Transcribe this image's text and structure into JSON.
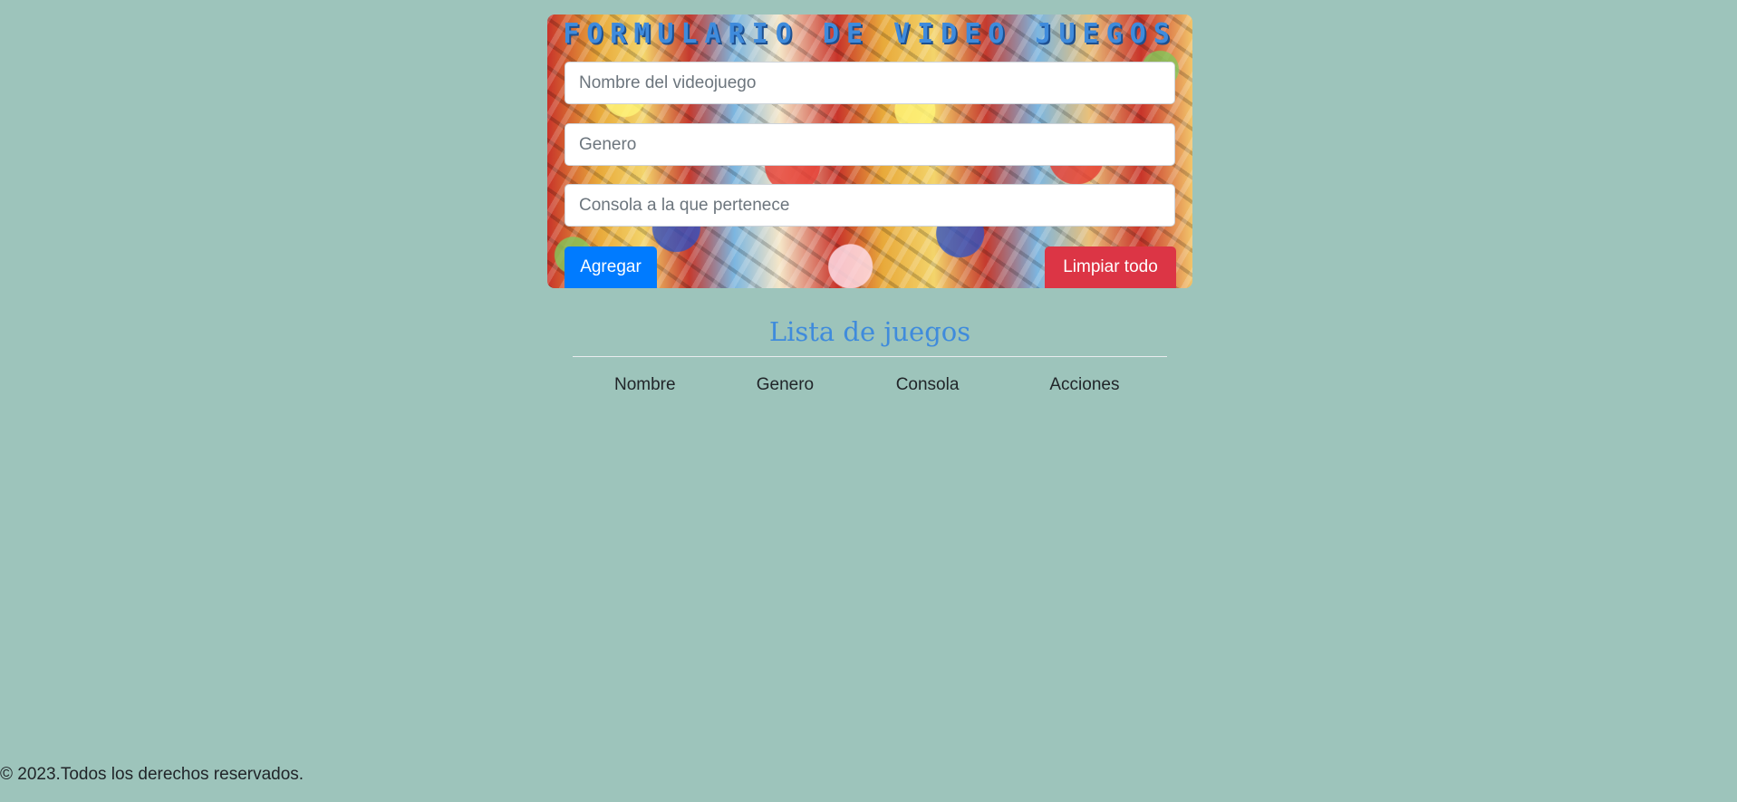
{
  "form": {
    "title": "FORMULARIO DE VIDEO JUEGOS",
    "fields": {
      "nombre_placeholder": "Nombre del videojuego",
      "genero_placeholder": "Genero",
      "consola_placeholder": "Consola a la que pertenece"
    },
    "buttons": {
      "agregar": "Agregar",
      "limpiar": "Limpiar todo"
    }
  },
  "list": {
    "title": "Lista de juegos",
    "columns": [
      "Nombre",
      "Genero",
      "Consola",
      "Acciones"
    ],
    "rows": []
  },
  "footer": {
    "text": "© 2023.Todos los derechos reservados."
  },
  "colors": {
    "page_background": "#9dc4bb",
    "title_blue": "#3f8bdc",
    "primary_button": "#007bff",
    "danger_button": "#dc3545"
  }
}
